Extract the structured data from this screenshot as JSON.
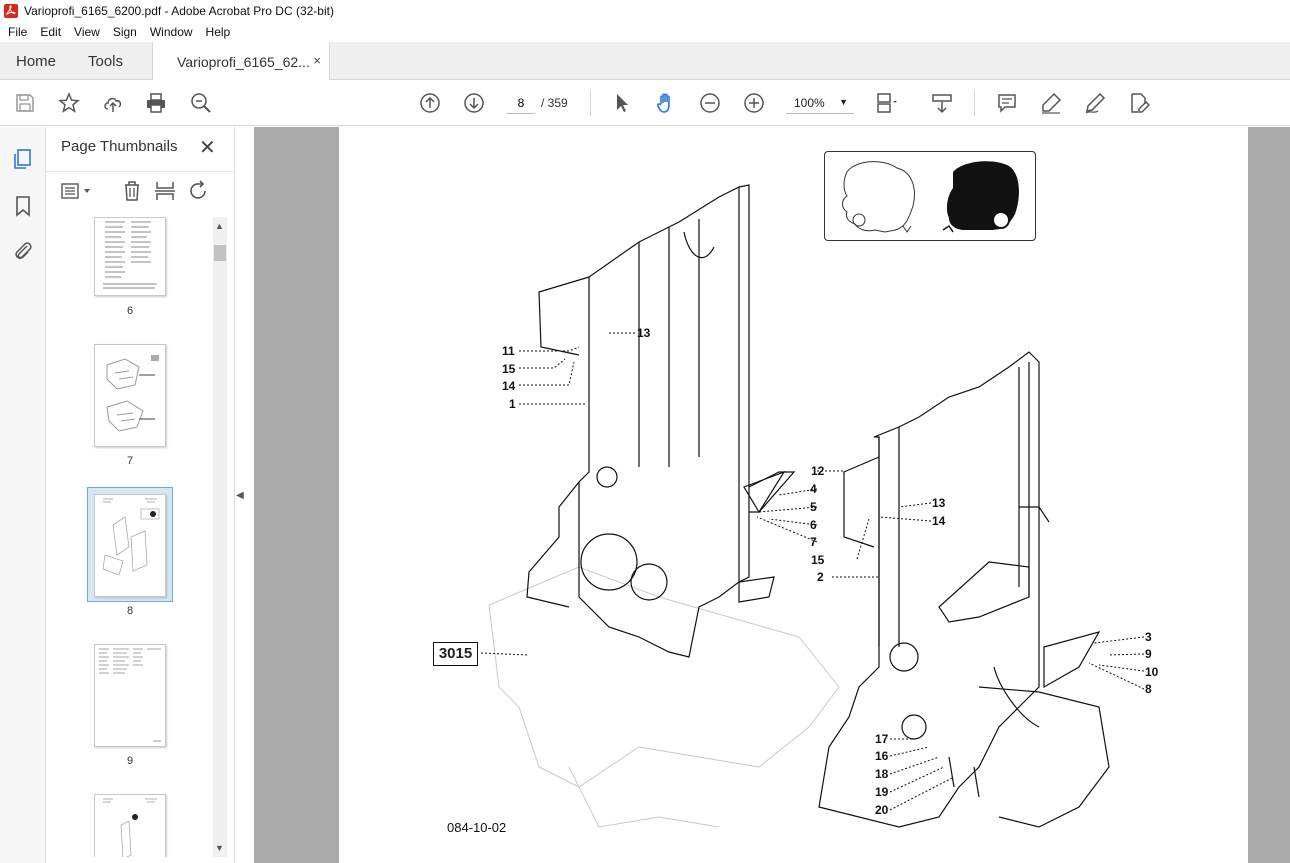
{
  "window": {
    "title": "Varioprofi_6165_6200.pdf - Adobe Acrobat Pro DC (32-bit)"
  },
  "menu": [
    "File",
    "Edit",
    "View",
    "Sign",
    "Window",
    "Help"
  ],
  "tabs": {
    "home": "Home",
    "tools": "Tools",
    "document": "Varioprofi_6165_62...",
    "close": "×"
  },
  "toolbar": {
    "page_current": "8",
    "page_total": "/ 359",
    "zoom": "100%"
  },
  "panel": {
    "title": "Page Thumbnails",
    "close": "✕",
    "thumbnails": [
      {
        "label": "6"
      },
      {
        "label": "7"
      },
      {
        "label": "8",
        "selected": true
      },
      {
        "label": "9"
      },
      {
        "label": ""
      }
    ]
  },
  "document": {
    "ref_box": "3015",
    "drawing_number": "084-10-02",
    "callouts": [
      "11",
      "15",
      "14",
      "1",
      "13",
      "12",
      "4",
      "5",
      "6",
      "7",
      "13",
      "14",
      "15",
      "2",
      "3",
      "9",
      "10",
      "8",
      "17",
      "16",
      "18",
      "19",
      "20"
    ]
  },
  "colors": {
    "selection": "#d6e6f5",
    "background_gray": "#aaaaaa",
    "accent_blue": "#2b7ad9",
    "acrobat_red": "#d9261c"
  }
}
